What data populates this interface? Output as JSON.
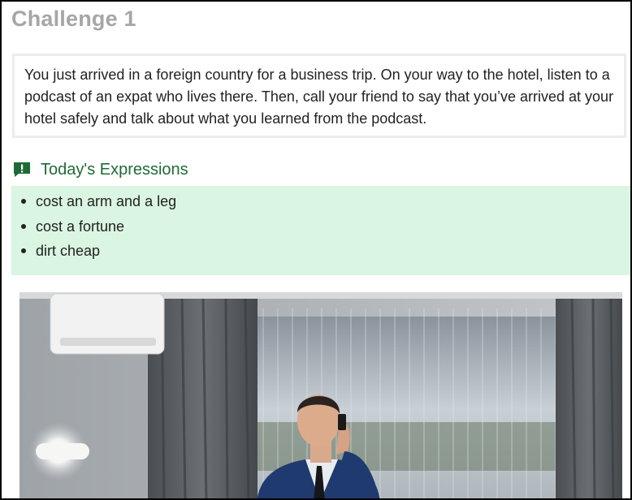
{
  "page": {
    "title": "Challenge 1"
  },
  "challenge": {
    "text": "You just arrived in a foreign country for a business trip. On your way to the hotel, listen to a podcast of an expat who lives there. Then, call your friend to say that you’ve arrived at your hotel safely and talk about what you learned from the podcast."
  },
  "expressions": {
    "icon": "speech-bubble-exclamation-icon",
    "title": "Today's Expressions",
    "items": [
      {
        "text": "cost an arm and a leg"
      },
      {
        "text": "cost a fortune"
      },
      {
        "text": "dirt cheap"
      }
    ]
  },
  "photo": {
    "alt": "Businessman in suit talking on phone in hotel room"
  },
  "colors": {
    "title": "#a6a6a6",
    "accent_green": "#1e6b37",
    "expressions_bg": "#daf5e1"
  }
}
